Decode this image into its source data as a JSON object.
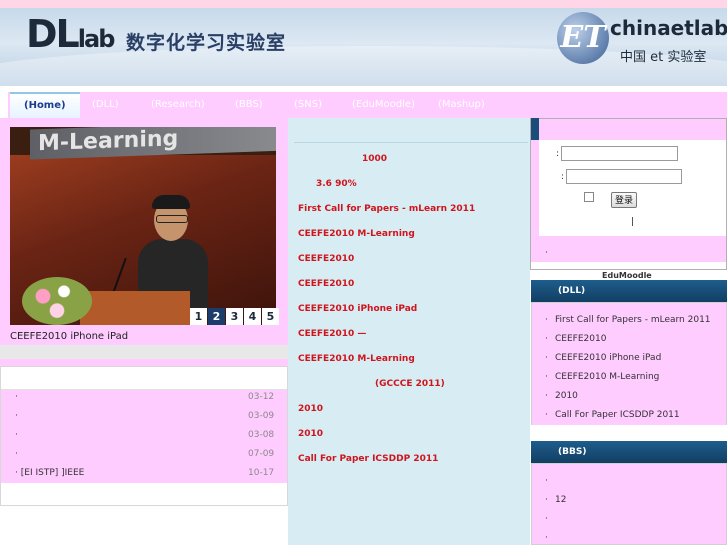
{
  "header": {
    "logo_dl": "DL",
    "logo_lab": "lab",
    "site_name": "数字化学习实验室",
    "partner_logo": "ET",
    "partner_name": "chinaetlab",
    "partner_sub": "中国 et 实验室"
  },
  "nav": {
    "items": [
      {
        "label": "(Home)",
        "active": true
      },
      {
        "label": "(DLL)"
      },
      {
        "label": "(Research)"
      },
      {
        "label": "(BBS)"
      },
      {
        "label": "(SNS)"
      },
      {
        "label": "(EduMoodle)"
      },
      {
        "label": "(Mashup)"
      }
    ]
  },
  "slideshow": {
    "banner_text": "M-Learning",
    "pages": [
      "1",
      "2",
      "3",
      "4",
      "5"
    ],
    "active_page": 2,
    "caption": "CEEFE2010      iPhone iPad"
  },
  "news": {
    "items": [
      {
        "bullet": "·",
        "title": "",
        "date": "03-12"
      },
      {
        "bullet": "·",
        "title": "",
        "date": "03-09"
      },
      {
        "bullet": "·",
        "title": "",
        "date": "03-08"
      },
      {
        "bullet": "·",
        "title": "",
        "date": "07-09"
      },
      {
        "bullet": "·",
        "title": "[EI  ISTP]     ]IEEE",
        "date": "10-17"
      }
    ]
  },
  "middle": {
    "items": [
      "1000",
      "3.6                      90%",
      "First Call for Papers - mLearn 2011",
      "CEEFE2010  M-Learning",
      "CEEFE2010",
      "CEEFE2010",
      "CEEFE2010            iPhone  iPad",
      "CEEFE2010                   —",
      "CEEFE2010             M-Learning",
      "(GCCCE 2011)",
      "2010",
      "2010",
      "Call For Paper ICSDDP 2011"
    ]
  },
  "login": {
    "user_label": ":",
    "pass_label": ":",
    "user_value": "",
    "pass_value": "",
    "button": "登录",
    "separator": "|",
    "bottom_bullet": "·"
  },
  "edumoodle_label": "EduMoodle",
  "dll_panel": {
    "title": "(DLL)",
    "items": [
      "First Call for Papers - mLearn 2011",
      "CEEFE2010",
      "CEEFE2010      iPhone iPad",
      "CEEFE2010      M-Learning",
      "2010",
      "Call For Paper ICSDDP 2011"
    ]
  },
  "bbs_panel": {
    "title": "(BBS)",
    "items": [
      "",
      "            12",
      "",
      ""
    ]
  }
}
